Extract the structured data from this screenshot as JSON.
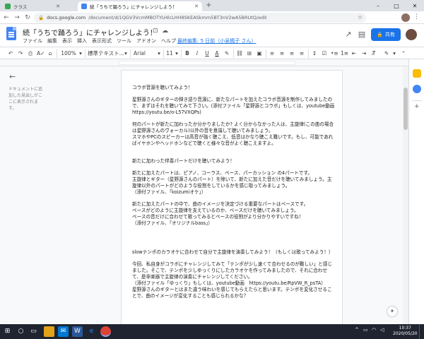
{
  "browser": {
    "tabs": [
      {
        "label": "クラス",
        "active": false
      },
      {
        "label": "続「うちで踊ろう」にチャレンジしよう！",
        "active": true
      }
    ],
    "url_host": "docs.google.com",
    "url_path": "/document/d/1QGV3VcmMBOTYU4lcLHH8SKEASkmm5BT3nV2wA5BRUtQ/edit"
  },
  "doc": {
    "title": "続「うちで踊ろう」にチャレンジしよう！",
    "menus": [
      "ファイル",
      "編集",
      "表示",
      "挿入",
      "表示形式",
      "ツール",
      "アドオン",
      "ヘルプ"
    ],
    "last_edit": "最終編集: 5 日前（小泉楓子 さん）",
    "share_label": "共有"
  },
  "toolbar": {
    "zoom": "100%",
    "style": "標準テキスト...",
    "font": "Arial",
    "size": "11"
  },
  "outline": {
    "hint": "ドキュメントに追加した見出しがここに表示されます。"
  },
  "body": {
    "p1": "コラボ音源を聴いてみよう！",
    "p2": "星野源さんのギターの弾き語り音源に、新たなパートを加えたコラボ音源を制作してみましたので、まずはそれを聴いてみて下さい。(添付ファイル「星野源とコラボ」もしくは、youtube動画　https://youtu.be/o-L57VXQPs)",
    "p3": "何のパートが新たに加わったか分かりましたか? よく分からなかった人は、主旋律(この曲の場合は星野源さんのヴォーカル)以外の音を意識して聴いてみましょう。\nスマホやPCのスピーカーは高音が強く聴こえ、低音はかなり聴こえ難いです。もし、可能であればイヤホンやヘッドホンなどで聴くと様々な音がよく聴こえますよ。",
    "p4": "新たに加わった伴奏パートだけを聴いてみよう！",
    "p5": "新たに加えたパートは、ピアノ、コーラス、ベース、パーカッション の4パートです。\n主旋律とギター（星野源さんのパート）を除いて、新たに加えた音だけを聴いてみましょう。主旋律以外のパートがどのような役割をしているかを感じ取ってみましょう。\n（添付ファイル、「koizumiオケ」）",
    "p6": "新たに加えたパートの中で、曲のイメージを決定づける重要なパートはベースです。\nベースがどのように主旋律を支えているのか、ベースだけを聴いてみましょう。\nベースの音だけに合わせて歌ってみるとベースの役割がより分かりやすいですね！\n（添付ファイル、「オリジナルbass」）",
    "p7": "slowテンポのカラオケに合わせて自分で主旋律を演奏してみよう！（もしくは歌ってみよう！）",
    "p8": "今回、私自身がコラボにチャレンジしてみて「テンポが少し速くて合わせるのが難しい」と感じました。そこで、テンポを少しゆっくりにしたカラオケを作ってみましたので、それに合わせて、是非楽器で主旋律の演奏にチャレンジしてください。\n（添付ファイル「ゆっくり」もしくは、youtube動画　https://youtu.be/RpVW_R_psTA）\n星野源さんのギターとはまた違う味わいを感じてもらえたらと思います。テンポを変化させることで、曲のイメージが変化することも感じられるかな？"
  },
  "taskbar": {
    "time": "10:37",
    "date": "2020/05/20"
  },
  "colors": {
    "accent": "#1a73e8",
    "docs_blue": "#4285f4"
  }
}
